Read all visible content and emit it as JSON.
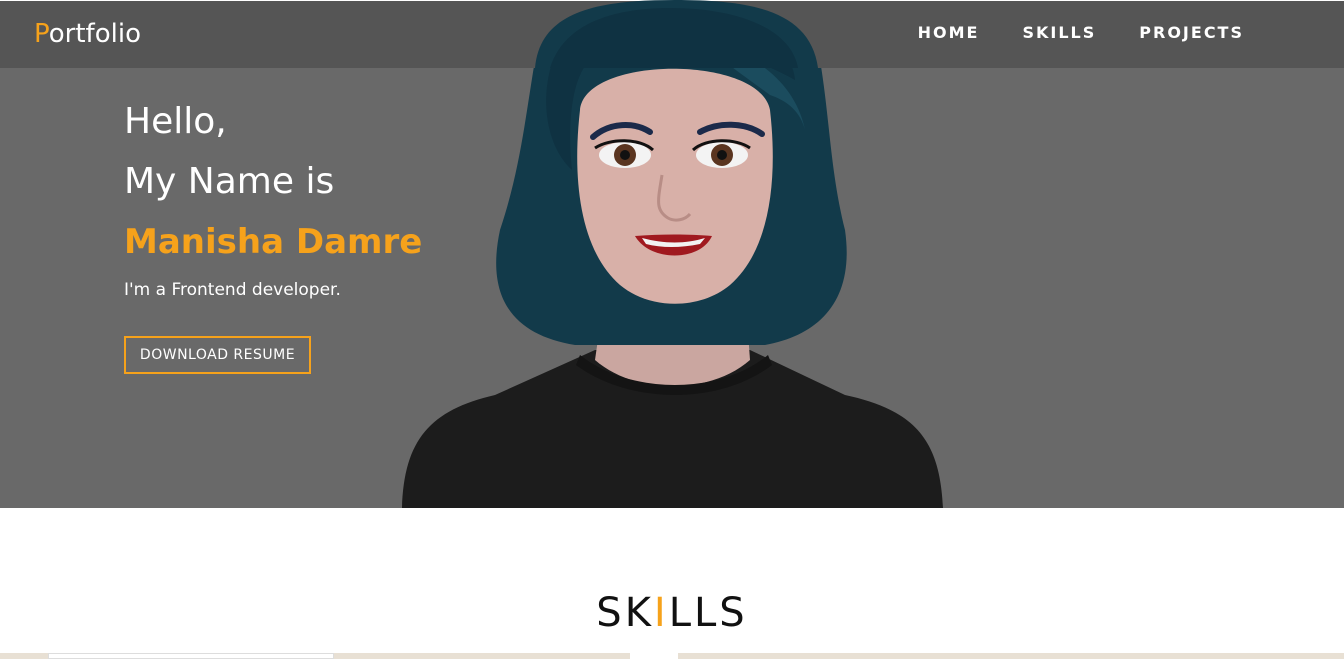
{
  "navbar": {
    "logo_first": "P",
    "logo_rest": "ortfolio",
    "links": [
      "HOME",
      "SKILLS",
      "PROJECTS"
    ]
  },
  "hero": {
    "greeting_line1": "Hello,",
    "greeting_line2": "My Name is",
    "name": "Manisha Damre",
    "role": "I'm a Frontend developer.",
    "resume_button": "DOWNLOAD RESUME"
  },
  "skills": {
    "title_part1": "SK",
    "title_accent": "I",
    "title_part2": "LLS"
  },
  "colors": {
    "accent": "#f6a21b",
    "navbar_bg": "#555555",
    "hero_bg": "#696969"
  },
  "icons": {
    "avatar": "cartoon-woman-avatar"
  }
}
